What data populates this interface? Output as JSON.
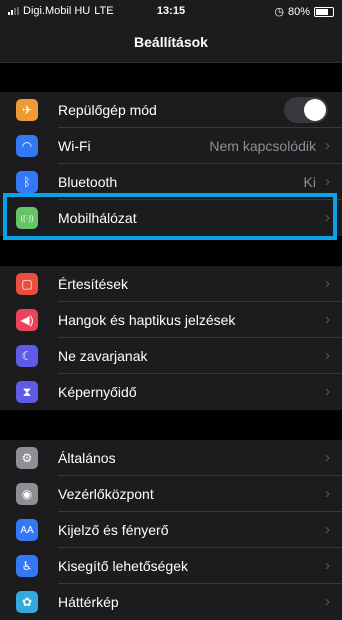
{
  "status_bar": {
    "carrier": "Digi.Mobil HU",
    "network": "LTE",
    "time": "13:15",
    "battery_percent": "80%"
  },
  "nav": {
    "title": "Beállítások"
  },
  "group1": [
    {
      "name": "repulogep-mod",
      "icon": "airplane-icon",
      "icon_color": "#f09a37",
      "label": "Repülőgép mód",
      "toggle": true,
      "toggle_on": false
    },
    {
      "name": "wifi",
      "icon": "wifi-icon",
      "icon_color": "#3478f6",
      "label": "Wi-Fi",
      "value": "Nem kapcsolódik"
    },
    {
      "name": "bluetooth",
      "icon": "bluetooth-icon",
      "icon_color": "#3478f6",
      "label": "Bluetooth",
      "value": "Ki"
    },
    {
      "name": "mobilhalozat",
      "icon": "cellular-icon",
      "icon_color": "#65c466",
      "label": "Mobilhálózat",
      "value": ""
    }
  ],
  "group2": [
    {
      "name": "ertesitesek",
      "icon": "notifications-icon",
      "icon_color": "#eb4e3d",
      "label": "Értesítések"
    },
    {
      "name": "hangok",
      "icon": "sounds-icon",
      "icon_color": "#eb445a",
      "label": "Hangok és haptikus jelzések"
    },
    {
      "name": "ne-zavarjanak",
      "icon": "moon-icon",
      "icon_color": "#5e5ce6",
      "label": "Ne zavarjanak"
    },
    {
      "name": "kepernyoido",
      "icon": "hourglass-icon",
      "icon_color": "#5e5ce6",
      "label": "Képernyőidő"
    }
  ],
  "group3": [
    {
      "name": "altalanos",
      "icon": "gear-icon",
      "icon_color": "#8e8e93",
      "label": "Általános"
    },
    {
      "name": "vezerlokozpont",
      "icon": "control-center-icon",
      "icon_color": "#8e8e93",
      "label": "Vezérlőközpont"
    },
    {
      "name": "kijelzo",
      "icon": "display-icon",
      "icon_color": "#3478f6",
      "label": "Kijelző és fényerő"
    },
    {
      "name": "kisegito",
      "icon": "accessibility-icon",
      "icon_color": "#3478f6",
      "label": "Kisegítő lehetőségek"
    },
    {
      "name": "hatterkep",
      "icon": "wallpaper-icon",
      "icon_color": "#34aadc",
      "label": "Háttérkép"
    }
  ],
  "highlight_color": "#0aa1e6",
  "icon_glyphs": {
    "airplane-icon": "✈",
    "wifi-icon": "◠",
    "bluetooth-icon": "ᛒ",
    "cellular-icon": "((·))",
    "notifications-icon": "▢",
    "sounds-icon": "◀)",
    "moon-icon": "☾",
    "hourglass-icon": "⧗",
    "gear-icon": "⚙",
    "control-center-icon": "◉",
    "display-icon": "AA",
    "accessibility-icon": "♿",
    "wallpaper-icon": "✿"
  }
}
